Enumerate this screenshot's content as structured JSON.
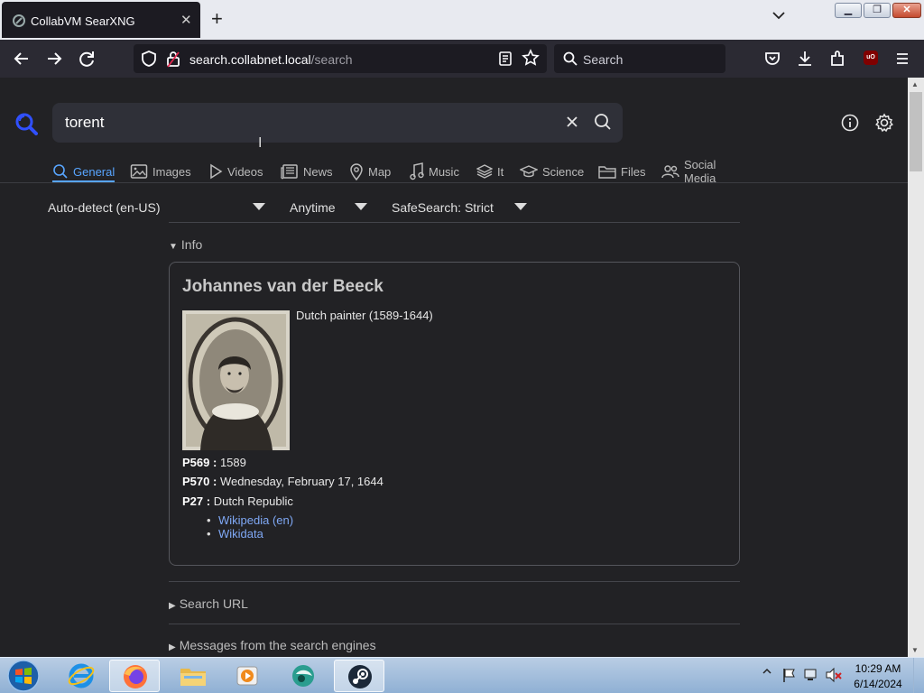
{
  "browser": {
    "tab_title": "CollabVM SearXNG",
    "url_host": "search.collabnet.local",
    "url_path": "/search",
    "search_placeholder": "Search"
  },
  "search": {
    "query": "torent"
  },
  "categories": [
    {
      "label": "General",
      "icon": "search-icon",
      "active": true
    },
    {
      "label": "Images",
      "icon": "image-icon"
    },
    {
      "label": "Videos",
      "icon": "play-icon"
    },
    {
      "label": "News",
      "icon": "newspaper-icon"
    },
    {
      "label": "Map",
      "icon": "map-pin-icon"
    },
    {
      "label": "Music",
      "icon": "music-note-icon"
    },
    {
      "label": "It",
      "icon": "layers-icon"
    },
    {
      "label": "Science",
      "icon": "graduation-cap-icon"
    },
    {
      "label": "Files",
      "icon": "folder-icon"
    },
    {
      "label": "Social Media",
      "icon": "people-icon"
    }
  ],
  "filters": {
    "language": "Auto-detect (en-US)",
    "time_range": "Anytime",
    "safesearch": "SafeSearch: Strict"
  },
  "info": {
    "summary": "Info",
    "title": "Johannes van der Beeck",
    "description": "Dutch painter (1589-1644)",
    "attributes": [
      {
        "key": "P569 :",
        "value": "1589"
      },
      {
        "key": "P570 :",
        "value": "Wednesday, February 17, 1644"
      },
      {
        "key": "P27 :",
        "value": "Dutch Republic"
      }
    ],
    "links": [
      "Wikipedia (en)",
      "Wikidata"
    ]
  },
  "sections": {
    "search_url": "Search URL",
    "engine_messages": "Messages from the search engines"
  },
  "taskbar": {
    "time": "10:29 AM",
    "date": "6/14/2024"
  },
  "colors": {
    "accent": "#58a5ff",
    "link": "#7fa8f5",
    "page_bg": "#222225"
  }
}
